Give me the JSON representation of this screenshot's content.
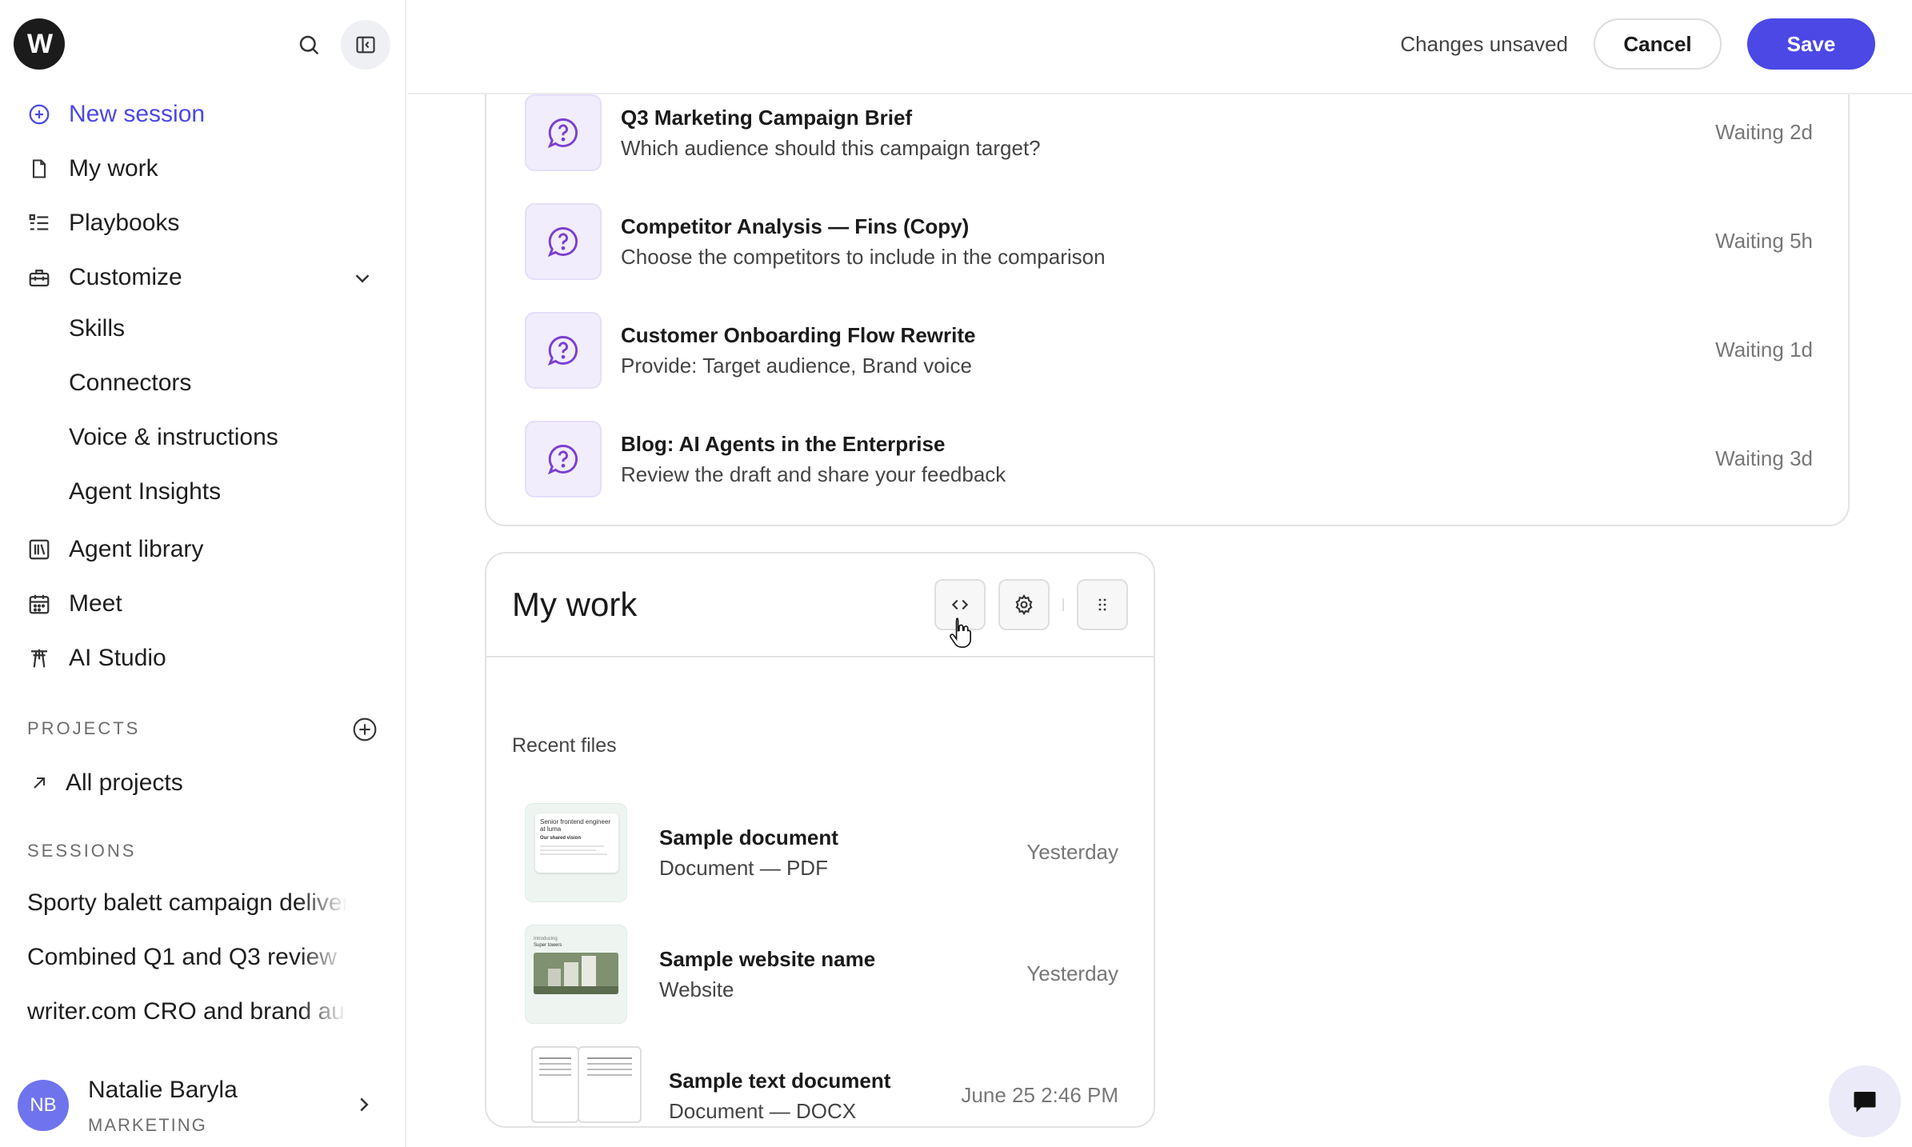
{
  "app": {
    "logo_letter": "W",
    "accent_color": "#4b48e6"
  },
  "sidebar": {
    "nav": [
      {
        "label": "New session",
        "icon": "plus-circle-icon"
      },
      {
        "label": "My work",
        "icon": "document-icon"
      },
      {
        "label": "Playbooks",
        "icon": "list-icon"
      },
      {
        "label": "Customize",
        "icon": "toolbox-icon"
      }
    ],
    "customize_items": [
      "Skills",
      "Connectors",
      "Voice & instructions",
      "Agent Insights"
    ],
    "nav2": [
      {
        "label": "Agent library",
        "icon": "library-icon"
      },
      {
        "label": "Meet",
        "icon": "calendar-icon"
      },
      {
        "label": "AI Studio",
        "icon": "studio-icon"
      }
    ],
    "projects_label": "PROJECTS",
    "all_projects": "All projects",
    "sessions_label": "SESSIONS",
    "sessions": [
      "Sporty balett campaign deliverables",
      "Combined Q1 and Q3 review",
      "writer.com CRO and brand audit"
    ],
    "user": {
      "initials": "NB",
      "name": "Natalie Baryla",
      "dept": "MARKETING"
    }
  },
  "topbar": {
    "status": "Changes unsaved",
    "cancel": "Cancel",
    "save": "Save"
  },
  "waiting": [
    {
      "title": "Q3 Marketing Campaign Brief",
      "subtitle": "Which audience should this campaign target?",
      "status": "Waiting 2d"
    },
    {
      "title": "Competitor Analysis — Fins (Copy)",
      "subtitle": "Choose the competitors to include in the comparison",
      "status": "Waiting 5h"
    },
    {
      "title": "Customer Onboarding Flow Rewrite",
      "subtitle": "Provide: Target audience, Brand voice",
      "status": "Waiting 1d"
    },
    {
      "title": "Blog: AI Agents in the Enterprise",
      "subtitle": "Review the draft and share your feedback",
      "status": "Waiting 3d"
    }
  ],
  "my_work": {
    "title": "My work",
    "recent_label": "Recent files",
    "files": [
      {
        "name": "Sample document",
        "type": "Document — PDF",
        "date": "Yesterday",
        "thumb_text1": "Senior frontend engineer at luma",
        "thumb_text2": "Our shared vision"
      },
      {
        "name": "Sample website name",
        "type": "Website",
        "date": "Yesterday",
        "thumb_text1": "Introducing",
        "thumb_text2": "Super towers"
      },
      {
        "name": "Sample text document",
        "type": "Document — DOCX",
        "date": "June 25 2:46 PM"
      }
    ]
  }
}
